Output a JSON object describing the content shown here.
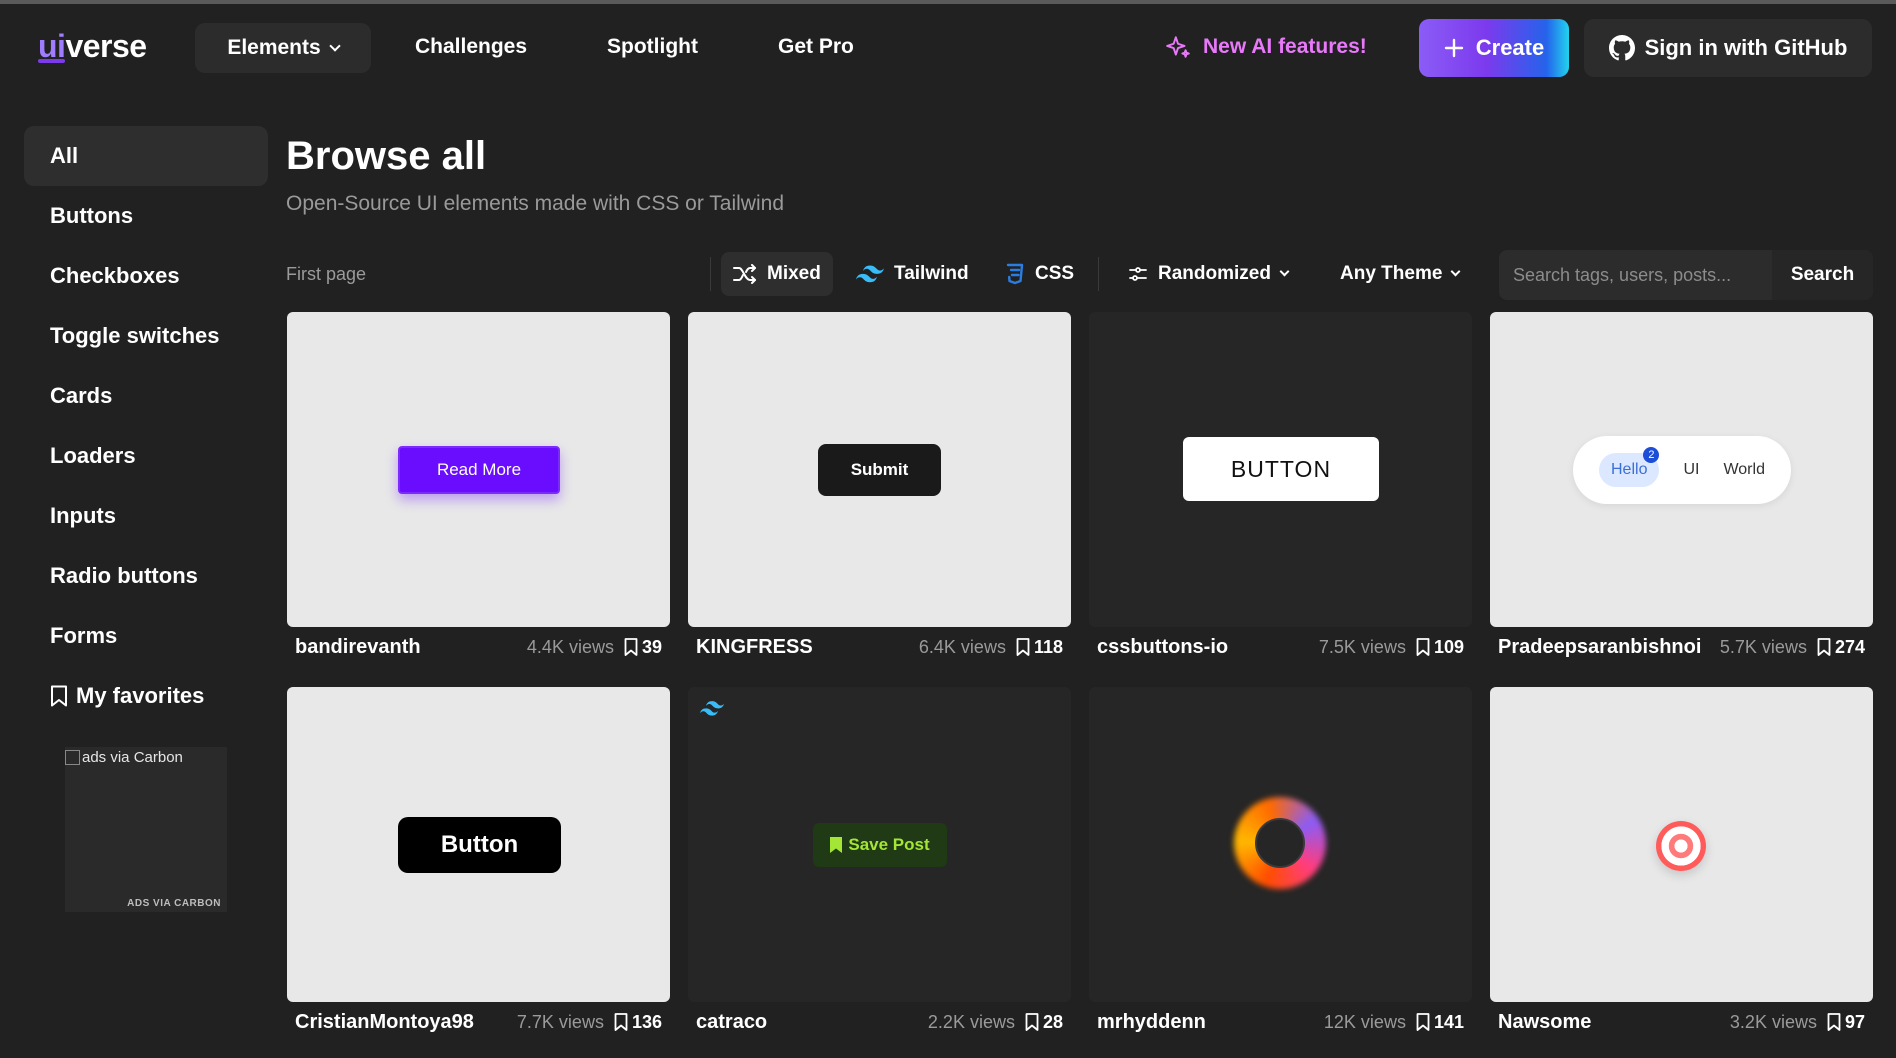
{
  "header": {
    "logo": {
      "ui": "ui",
      "rest": "verse"
    },
    "nav": {
      "elements": "Elements",
      "challenges": "Challenges",
      "spotlight": "Spotlight",
      "get_pro": "Get Pro"
    },
    "ai_link": "New AI features!",
    "create": "Create",
    "github": "Sign in with GitHub"
  },
  "sidebar": {
    "items": [
      {
        "label": "All",
        "active": true
      },
      {
        "label": "Buttons"
      },
      {
        "label": "Checkboxes"
      },
      {
        "label": "Toggle switches"
      },
      {
        "label": "Cards"
      },
      {
        "label": "Loaders"
      },
      {
        "label": "Inputs"
      },
      {
        "label": "Radio buttons"
      },
      {
        "label": "Forms"
      },
      {
        "label": "My favorites"
      }
    ],
    "ad": {
      "alt": "ads via Carbon",
      "label": "ADS VIA CARBON"
    }
  },
  "main": {
    "title": "Browse all",
    "subtitle": "Open-Source UI elements made with CSS or Tailwind",
    "pagination": "First page",
    "filters": {
      "mixed": "Mixed",
      "tailwind": "Tailwind",
      "css": "CSS",
      "sort": "Randomized",
      "theme": "Any Theme"
    },
    "search": {
      "placeholder": "Search tags, users, posts...",
      "button": "Search"
    }
  },
  "cards": [
    {
      "author": "bandirevanth",
      "views": "4.4K views",
      "saves": "39",
      "demo": "Read More"
    },
    {
      "author": "KINGFRESS",
      "views": "6.4K views",
      "saves": "118",
      "demo": "Submit"
    },
    {
      "author": "cssbuttons-io",
      "views": "7.5K views",
      "saves": "109",
      "demo": "BUTTON"
    },
    {
      "author": "Pradeepsaranbishnoi",
      "views": "5.7K views",
      "saves": "274",
      "demo": [
        "Hello",
        "UI",
        "World"
      ],
      "badge": "2"
    },
    {
      "author": "CristianMontoya98",
      "views": "7.7K views",
      "saves": "136",
      "demo": "Button"
    },
    {
      "author": "catraco",
      "views": "2.2K views",
      "saves": "28",
      "demo": "Save Post"
    },
    {
      "author": "mrhyddenn",
      "views": "12K views",
      "saves": "141"
    },
    {
      "author": "Nawsome",
      "views": "3.2K views",
      "saves": "97"
    }
  ],
  "colors": {
    "background": "#212121",
    "accent": "#7c3aed",
    "ai_pink": "#e879f9",
    "tailwind_blue": "#38bdf8",
    "css_blue": "#2a7de1"
  }
}
